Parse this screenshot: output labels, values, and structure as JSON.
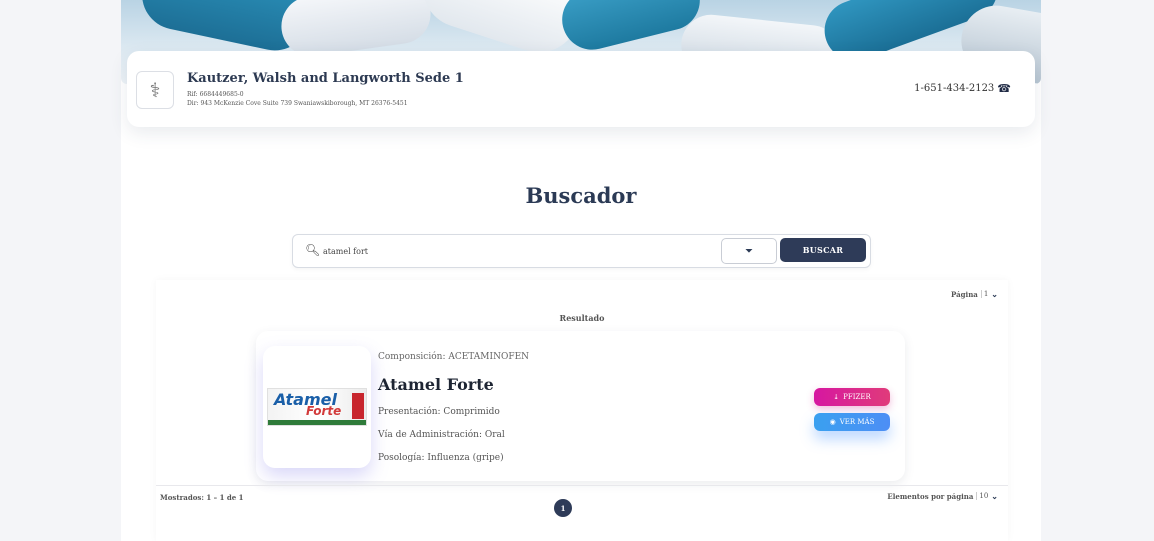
{
  "header": {
    "company_name": "Kautzer, Walsh and Langworth Sede 1",
    "rif": "Rif: 6684449685-0",
    "direccion": "Dir: 943 McKenzie Cove Suite 739 Swaniawskiborough, MT 26376-5451",
    "phone": "1-651-434-2123",
    "logo_icon": "caduceus-icon"
  },
  "page_title": "Buscador",
  "search": {
    "value": "atamel fort",
    "filter_icon": "filter-icon",
    "button_label": "BUSCAR"
  },
  "results": {
    "pagina_label": "Página",
    "pagina_value": "1",
    "section_title": "Resultado",
    "items": [
      {
        "composicion": "Componsición: ACETAMINOFEN",
        "name": "Atamel Forte",
        "presentacion": "Presentación: Comprimido",
        "via": "Vía de Administración: Oral",
        "posologia": "Posología: Influenza (gripe)",
        "image_brand": "Atamel",
        "image_sub": "Forte",
        "lab_button": "PFIZER",
        "ver_mas_button": "VER MÁS"
      }
    ],
    "mostrados": "Mostrados: 1 – 1 de 1",
    "current_page": "1",
    "elementos_label": "Elementos por página",
    "elementos_value": "10"
  },
  "colors": {
    "primary": "#2e3b58",
    "pfizer": "#d617a1",
    "ver_mas": "#3aa0f0"
  }
}
